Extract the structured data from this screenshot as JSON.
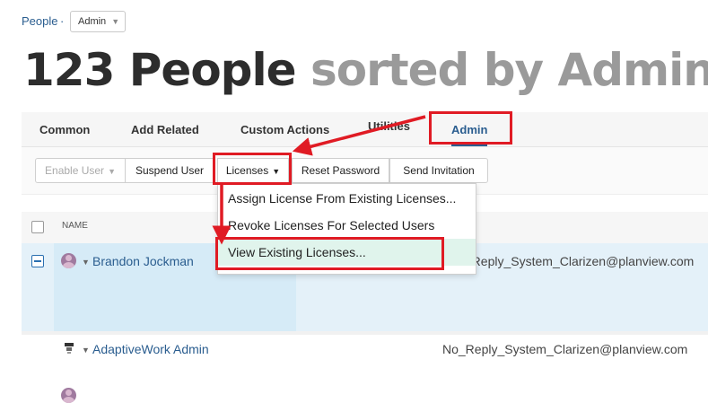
{
  "breadcrumb": {
    "link": "People",
    "separator": "·",
    "select_value": "Admin"
  },
  "page_title": {
    "count_text": "123 People",
    "sorted_text": "sorted by Admin"
  },
  "tabs": [
    {
      "label": "Common"
    },
    {
      "label": "Add Related"
    },
    {
      "label": "Custom Actions"
    },
    {
      "label": "Utilities"
    },
    {
      "label": "Admin"
    }
  ],
  "toolbar": {
    "enable_user": "Enable User",
    "suspend_user": "Suspend User",
    "licenses": "Licenses",
    "reset_password": "Reset Password",
    "send_invitation": "Send Invitation"
  },
  "table": {
    "column_name": "NAME",
    "rows": [
      {
        "name": "Brandon Jockman",
        "email": "No_Reply_System_Clarizen@planview.com"
      },
      {
        "name": "AdaptiveWork Admin",
        "email": "No_Reply_System_Clarizen@planview.com"
      }
    ]
  },
  "licenses_menu": {
    "items": [
      {
        "label": "Assign License From Existing Licenses..."
      },
      {
        "label": "Revoke Licenses For Selected Users"
      },
      {
        "label": "View Existing Licenses..."
      }
    ]
  },
  "colors": {
    "accent": "#2a5d8f",
    "annotation_red": "#e01b24",
    "selected_row": "#e4f1f9",
    "menu_highlight": "#e0f4ec"
  }
}
